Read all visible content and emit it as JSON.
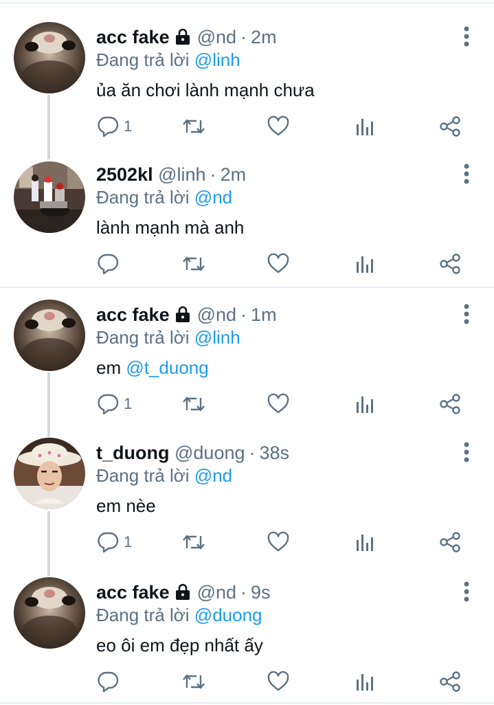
{
  "tweets": [
    {
      "name": "acc fake",
      "handle": "@nd",
      "sep": "·",
      "time": "2m",
      "reply_prefix": "Đang trả lời",
      "reply_to": "@linh",
      "text": "ủa ăn chơi lành mạnh chưa",
      "reply_count": "1",
      "locked": true,
      "avatar": "cat-photo"
    },
    {
      "name": "2502kl",
      "handle": "@linh",
      "sep": "·",
      "time": "2m",
      "reply_prefix": "Đang trả lời",
      "reply_to": "@nd",
      "text": "lành mạnh mà anh",
      "reply_count": "",
      "locked": false,
      "avatar": "street-scooter-photo"
    },
    {
      "name": "acc fake",
      "handle": "@nd",
      "sep": "·",
      "time": "1m",
      "reply_prefix": "Đang trả lời",
      "reply_to": "@linh",
      "text_prefix": "em ",
      "text_mention": "@t_duong",
      "reply_count": "1",
      "locked": true,
      "avatar": "cat-photo"
    },
    {
      "name": "t_duong",
      "handle": "@duong",
      "sep": "·",
      "time": "38s",
      "reply_prefix": "Đang trả lời",
      "reply_to": "@nd",
      "text": "em nèe",
      "reply_count": "1",
      "locked": false,
      "avatar": "person-cowboy-hat-photo"
    },
    {
      "name": "acc fake",
      "handle": "@nd",
      "sep": "·",
      "time": "9s",
      "reply_prefix": "Đang trả lời",
      "reply_to": "@duong",
      "text": "eo ôi em đẹp nhất ấy",
      "reply_count": "",
      "locked": true,
      "avatar": "cat-photo"
    }
  ],
  "icons": {
    "reply": "speech-bubble-icon",
    "retweet": "retweet-icon",
    "like": "heart-icon",
    "stats": "bar-chart-icon",
    "share": "share-icon",
    "menu": "vertical-dots-icon",
    "lock": "lock-icon"
  },
  "colors": {
    "mention": "#1d9bf0",
    "secondary_text": "#5b7083",
    "icon": "#5b7083",
    "divider": "#e6ecf0",
    "thread_line": "#cfd9de"
  }
}
